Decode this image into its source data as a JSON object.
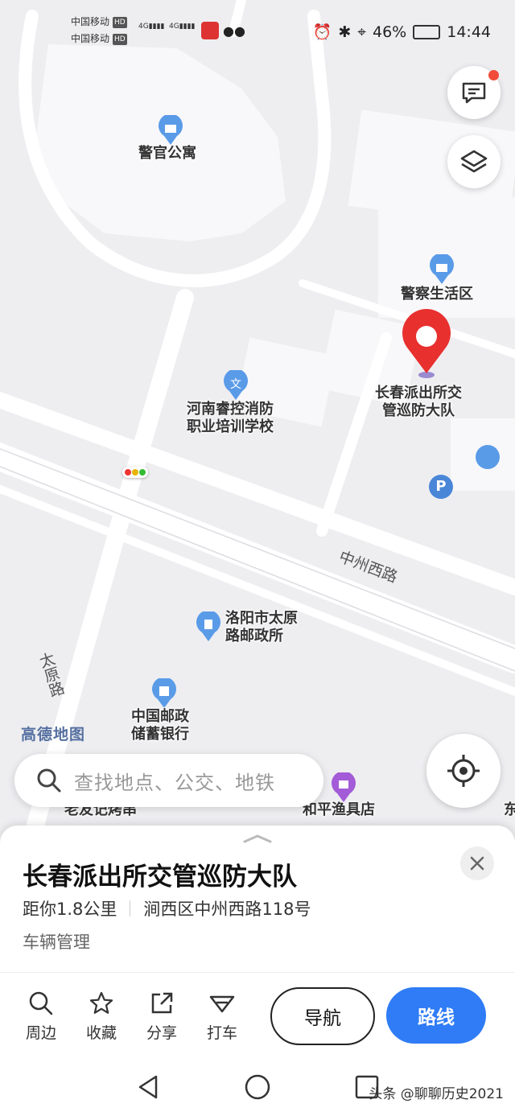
{
  "status_bar": {
    "carrier1": "中国移动",
    "carrier2": "中国移动",
    "hd": "HD",
    "network": "4G",
    "battery": "46%",
    "time": "14:44"
  },
  "map": {
    "pois": [
      {
        "name": "警官公寓",
        "icon": "building-icon"
      },
      {
        "name": "警察生活区",
        "icon": "building-icon"
      },
      {
        "name": "河南睿控消防职业培训学校",
        "line1": "河南睿控消防",
        "line2": "职业培训学校",
        "icon": "school-icon"
      },
      {
        "name": "洛阳市太原路邮政所",
        "line1": "洛阳市太原",
        "line2": "路邮政所",
        "icon": "post-icon"
      },
      {
        "name": "中国邮政储蓄银行",
        "line1": "中国邮政",
        "line2": "储蓄银行",
        "icon": "bank-icon"
      },
      {
        "name": "和平渔具店",
        "icon": "shop-icon"
      },
      {
        "name": "老友记烤串",
        "icon": "food-icon"
      }
    ],
    "selected_pin": {
      "line1": "长春派出所交",
      "line2": "管巡防大队"
    },
    "roads": [
      "中州西路",
      "太原路"
    ],
    "watermark": "高德地图",
    "parking_label": "P",
    "edge_char": "东"
  },
  "search": {
    "placeholder": "查找地点、公交、地铁"
  },
  "place": {
    "title": "长春派出所交管巡防大队",
    "distance": "距你1.8公里",
    "address": "涧西区中州西路118号",
    "category": "车辆管理"
  },
  "actions": [
    {
      "label": "周边",
      "icon": "search-icon"
    },
    {
      "label": "收藏",
      "icon": "star-icon"
    },
    {
      "label": "分享",
      "icon": "share-icon"
    },
    {
      "label": "打车",
      "icon": "taxi-icon"
    }
  ],
  "buttons": {
    "navigate": "导航",
    "route": "路线"
  },
  "credit": "头条 @聊聊历史2021",
  "colors": {
    "accent": "#2f7cf6",
    "pin": "#e8302f",
    "poi_blue": "#5a9be8"
  }
}
